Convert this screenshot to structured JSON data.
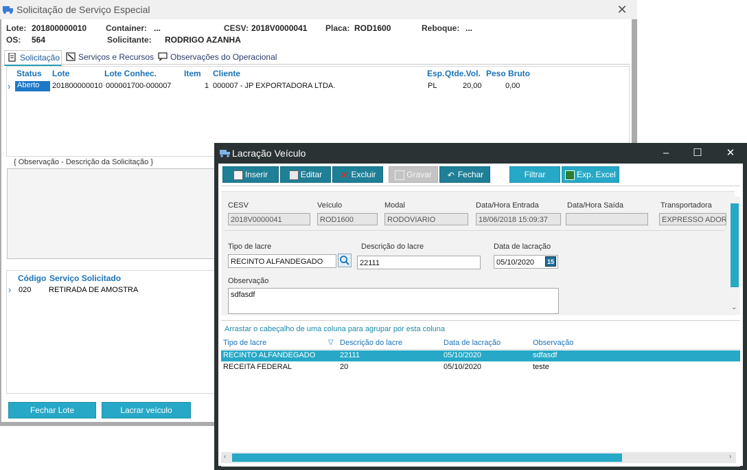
{
  "background_window": {
    "title": "Solicitação de Serviço Especial",
    "header": {
      "lote_label": "Lote:",
      "lote_value": "201800000010",
      "container_label": "Container:",
      "container_value": "...",
      "cesv_label": "CESV:",
      "cesv_value": "2018V0000041",
      "placa_label": "Placa:",
      "placa_value": "ROD1600",
      "reboque_label": "Reboque:",
      "reboque_value": "...",
      "os_label": "OS:",
      "os_value": "564",
      "solicitante_label": "Solicitante:",
      "solicitante_value": "RODRIGO AZANHA"
    },
    "tabs": [
      {
        "label": "Solicitação"
      },
      {
        "label": "Serviços e Recursos"
      },
      {
        "label": "Observações do Operacional"
      }
    ],
    "lots_grid": {
      "columns": [
        "Status",
        "Lote",
        "Lote Conhec.",
        "Item",
        "Cliente",
        "Esp.",
        "Qtde.Vol.",
        "Peso Bruto"
      ],
      "row": {
        "status": "Aberto",
        "lote": "201800000010",
        "lote_conhec": "000001700-000007",
        "item": "1",
        "cliente": "000007 - JP EXPORTADORA LTDA.",
        "esp": "PL",
        "qtde_vol": "20,00",
        "peso_bruto": "0,00"
      }
    },
    "obs_label": "{ Observação - Descrição da Solicitação }",
    "services_grid": {
      "columns": [
        "Código",
        "Serviço Solicitado"
      ],
      "row": {
        "codigo": "020",
        "servico": "RETIRADA DE AMOSTRA"
      }
    },
    "buttons": {
      "fechar_lote": "Fechar Lote",
      "lacrar_veiculo": "Lacrar veículo"
    }
  },
  "dialog": {
    "title": "Lacração Veículo",
    "toolbar": {
      "inserir": "Inserir",
      "editar": "Editar",
      "excluir": "Excluir",
      "gravar": "Gravar",
      "fechar": "Fechar",
      "filtrar": "Filtrar",
      "exp_excel": "Exp. Excel"
    },
    "fields": {
      "cesv_label": "CESV",
      "cesv_value": "2018V0000041",
      "veiculo_label": "Veículo",
      "veiculo_value": "ROD1600",
      "modal_label": "Modal",
      "modal_value": "RODOVIARIO",
      "entrada_label": "Data/Hora Entrada",
      "entrada_value": "18/06/2018 15:09:37",
      "saida_label": "Data/Hora Saída",
      "saida_value": "",
      "transportadora_label": "Transportadora",
      "transportadora_value": "EXPRESSO ADORNO",
      "tipo_lacre_label": "Tipo de lacre",
      "tipo_lacre_value": "RECINTO ALFANDEGADO",
      "descricao_label": "Descrição do lacre",
      "descricao_value": "22111",
      "data_lacracao_label": "Data de lacração",
      "data_lacracao_value": "05/10/2020",
      "calendar_day": "15",
      "observacao_label": "Observação",
      "observacao_value": "sdfasdf"
    },
    "grid": {
      "group_hint": "Arrastar o cabeçalho de uma coluna para agrupar por esta coluna",
      "columns": [
        "Tipo de lacre",
        "Descrição do lacre",
        "Data de lacração",
        "Observação"
      ],
      "rows": [
        {
          "tipo": "RECINTO ALFANDEGADO",
          "descricao": "22111",
          "data": "05/10/2020",
          "obs": "sdfasdf"
        },
        {
          "tipo": "RECEITA FEDERAL",
          "descricao": "20",
          "data": "05/10/2020",
          "obs": "teste"
        }
      ]
    }
  },
  "colors": {
    "accent": "#26a8c6",
    "toolbar_dark": "#1f7f96",
    "dialog_frame": "#2b3233",
    "header_blue": "#1a72b8"
  }
}
